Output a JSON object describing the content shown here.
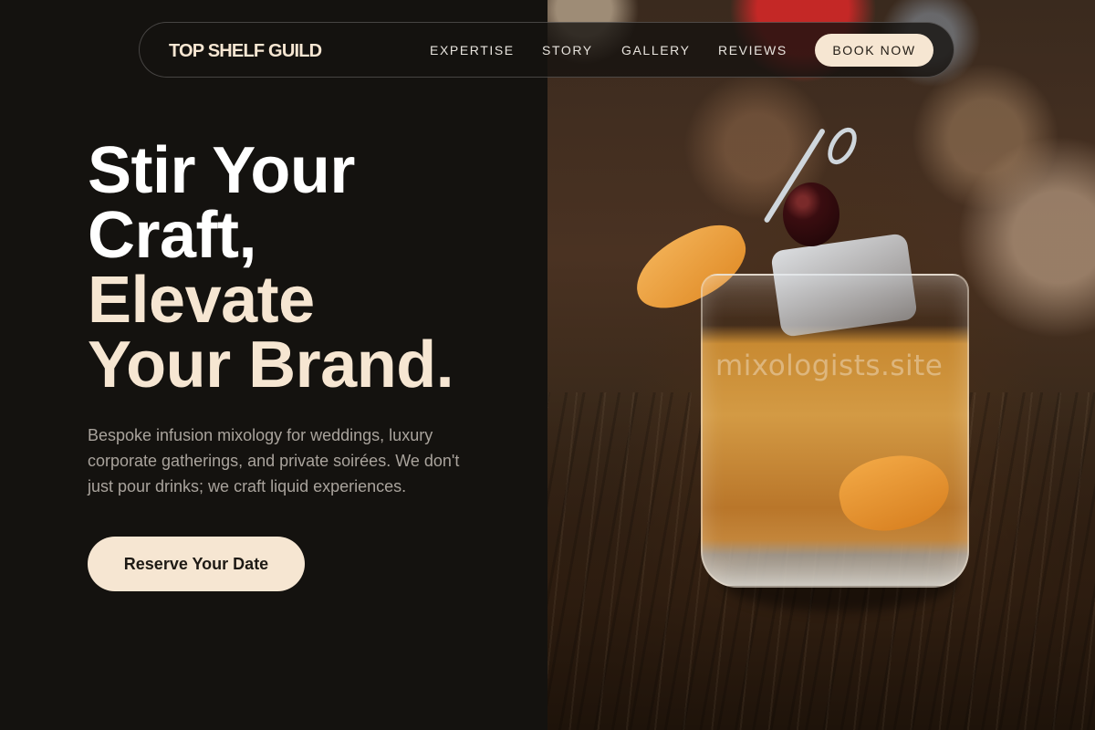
{
  "nav": {
    "brand": "TOP SHELF GUILD",
    "links": [
      "EXPERTISE",
      "STORY",
      "GALLERY",
      "REVIEWS"
    ],
    "cta": "BOOK NOW"
  },
  "hero": {
    "headline": {
      "line1": "Stir Your",
      "line2": "Craft,",
      "line3": "Elevate",
      "line4": "Your Brand."
    },
    "subtitle": "Bespoke infusion mixology for weddings, luxury corporate gatherings, and private soirées. We don't just pour drinks; we craft liquid experiences.",
    "cta": "Reserve Your Date"
  },
  "image": {
    "watermark": "mixologists.site",
    "subject": "old-fashioned-cocktail-photo"
  },
  "colors": {
    "background": "#14120f",
    "accent": "#f6e6d2",
    "headline_white": "#ffffff",
    "body_text": "#a9a39c"
  }
}
